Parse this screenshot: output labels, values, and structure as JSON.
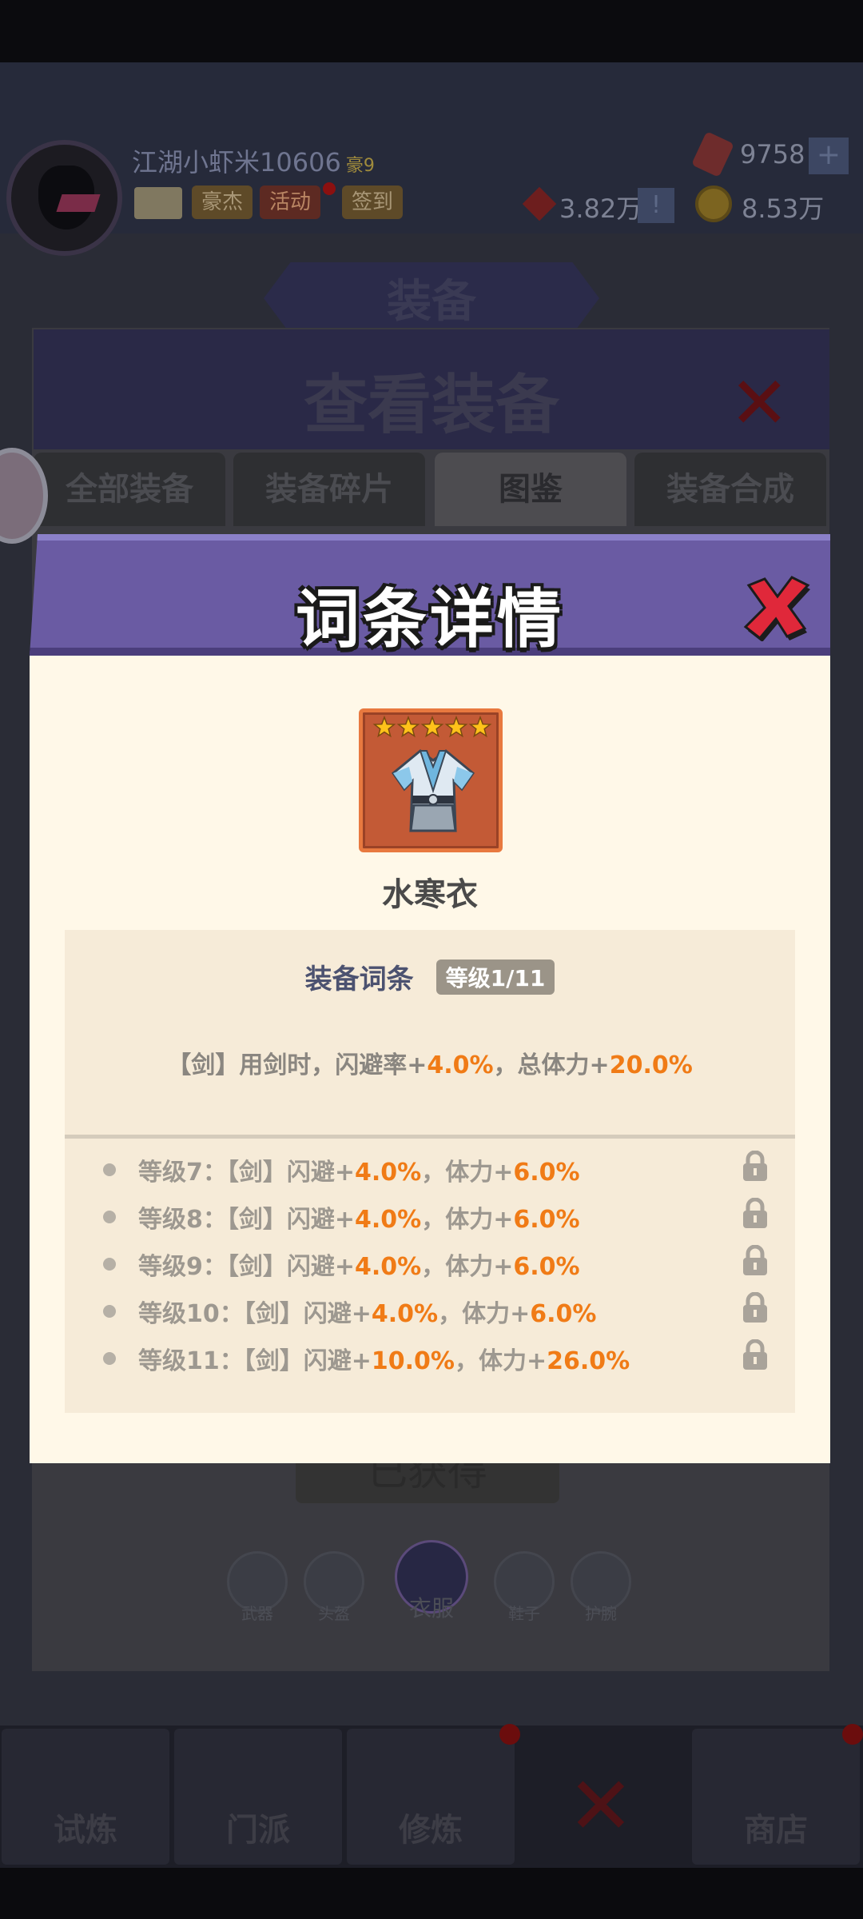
{
  "player": {
    "name": "江湖小虾米10606",
    "vip": "豪9",
    "buttons": [
      "豪杰",
      "活动",
      "签到"
    ]
  },
  "resources": {
    "gems": "9758",
    "power": "3.82万",
    "gold": "8.53万",
    "plus": "+",
    "info": "!"
  },
  "screen": {
    "title": "装备",
    "panel_title": "查看装备",
    "tabs": [
      "全部装备",
      "装备碎片",
      "图鉴",
      "装备合成"
    ],
    "active_tab": "图鉴",
    "obtained_label": "已获得",
    "slots": [
      "武器",
      "头盔",
      "衣服",
      "鞋子",
      "护腕"
    ],
    "active_slot": "衣服"
  },
  "bottom_nav": [
    "试炼",
    "门派",
    "修炼",
    "",
    "商店"
  ],
  "dialog": {
    "title": "词条详情",
    "item": {
      "name": "水寒衣",
      "stars": 5
    },
    "affix": {
      "title": "装备词条",
      "level": "等级1/11",
      "desc_prefix": "【剑】用剑时，闪避率+",
      "desc_v1": "4.0%",
      "desc_mid": "，总体力+",
      "desc_v2": "20.0%"
    },
    "levels": [
      {
        "prefix": "等级7：【剑】闪避+",
        "v1": "4.0%",
        "mid": "，体力+",
        "v2": "6.0%"
      },
      {
        "prefix": "等级8：【剑】闪避+",
        "v1": "4.0%",
        "mid": "，体力+",
        "v2": "6.0%"
      },
      {
        "prefix": "等级9：【剑】闪避+",
        "v1": "4.0%",
        "mid": "，体力+",
        "v2": "6.0%"
      },
      {
        "prefix": "等级10：【剑】闪避+",
        "v1": "4.0%",
        "mid": "，体力+",
        "v2": "6.0%"
      },
      {
        "prefix": "等级11：【剑】闪避+",
        "v1": "10.0%",
        "mid": "，体力+",
        "v2": "26.0%"
      }
    ]
  },
  "colors": {
    "dialog_header": "#6a5ba3",
    "dialog_body": "#fff8e8",
    "accent_orange": "#f07b16",
    "close_red": "#e0283a"
  }
}
